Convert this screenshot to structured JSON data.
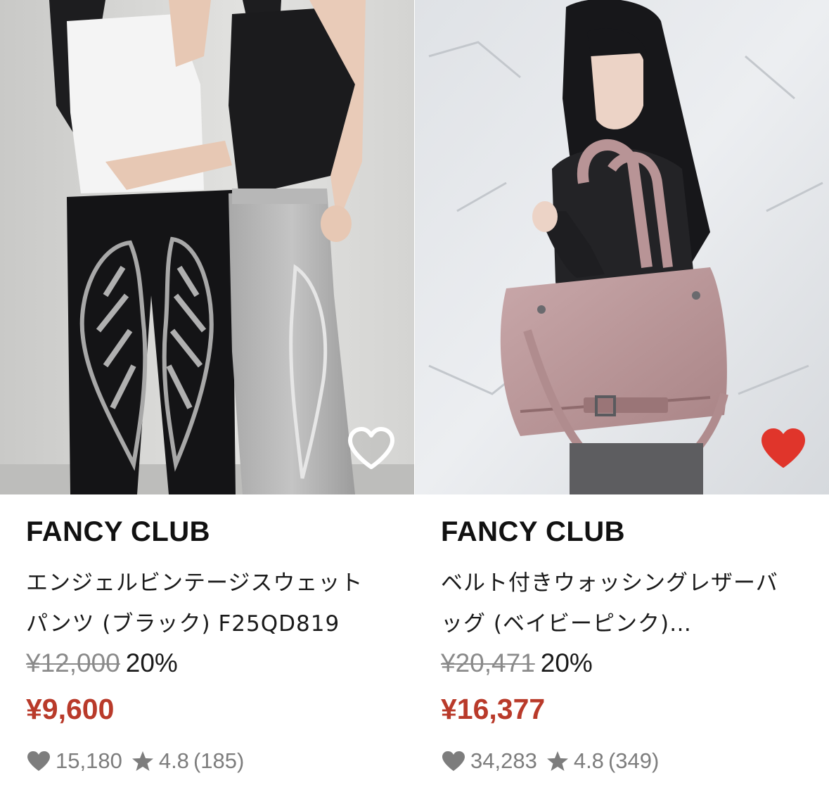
{
  "products": [
    {
      "brand": "FANCY CLUB",
      "name_line1": "エンジェルビンテージスウェット",
      "name_line2": "パンツ (ブラック) F25QD819",
      "original_price": "¥12,000",
      "discount": "20%",
      "sale_price": "¥9,600",
      "likes": "15,180",
      "rating": "4.8",
      "reviews": "(185)",
      "favorited": false,
      "photo_icon": "wing-print-sweatpants-photo",
      "heart_color": "#ffffff"
    },
    {
      "brand": "FANCY CLUB",
      "name_line1": "ベルト付きウォッシングレザーバ",
      "name_line2": "ッグ (ベイビーピンク)…",
      "original_price": "¥20,471",
      "discount": "20%",
      "sale_price": "¥16,377",
      "likes": "34,283",
      "rating": "4.8",
      "reviews": "(349)",
      "favorited": true,
      "photo_icon": "pink-leather-bag-photo",
      "heart_color": "#e0352b"
    }
  ],
  "colors": {
    "sale": "#b93a2a",
    "muted": "#7d7d7d",
    "favorite_active": "#e0352b"
  }
}
